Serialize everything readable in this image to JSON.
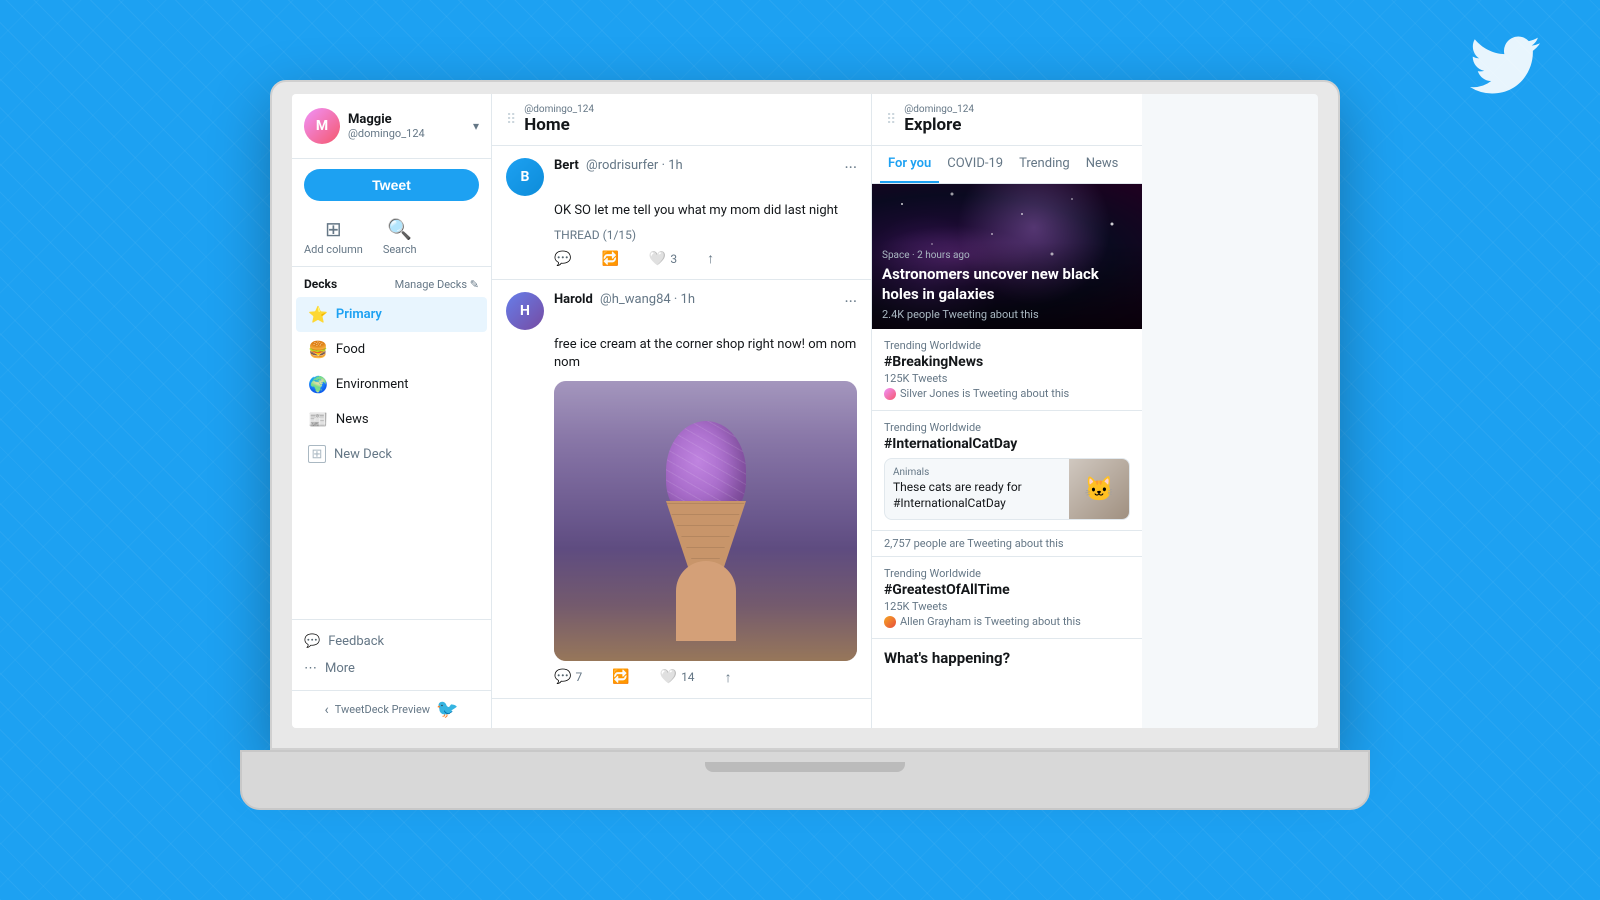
{
  "background": {
    "color": "#1da1f2"
  },
  "twitter_logo": "🐦",
  "laptop": {
    "screen": {
      "sidebar": {
        "user": {
          "name": "Maggie",
          "handle": "@domingo_124",
          "avatar_letter": "M"
        },
        "tweet_button": "Tweet",
        "actions": [
          {
            "icon": "⊞",
            "label": "Add column"
          },
          {
            "icon": "🔍",
            "label": "Search"
          }
        ],
        "decks_title": "Decks",
        "manage_decks": "Manage Decks",
        "decks": [
          {
            "icon": "⭐",
            "label": "Primary",
            "active": true,
            "color": "#f5a623"
          },
          {
            "icon": "🍔",
            "label": "Food",
            "active": false,
            "color": "#f5a623"
          },
          {
            "icon": "🌍",
            "label": "Environment",
            "active": false,
            "color": "#27ae60"
          },
          {
            "icon": "📰",
            "label": "News",
            "active": false,
            "color": "#3498db"
          },
          {
            "icon": "➕",
            "label": "New Deck",
            "active": false,
            "color": "#657786"
          }
        ],
        "footer": [
          {
            "icon": "💬",
            "label": "Feedback"
          },
          {
            "icon": "⋯",
            "label": "More"
          }
        ],
        "preview": {
          "arrow": "‹",
          "text": "TweetDeck Preview"
        }
      },
      "home_column": {
        "subtitle": "@domingo_124",
        "title": "Home",
        "tweets": [
          {
            "author": "Bert",
            "handle": "@rodrisurfer",
            "time": "1h",
            "body": "OK SO let me tell you what my mom did last night",
            "thread": "THREAD (1/15)",
            "actions": {
              "reply": "",
              "retweet": "",
              "like": "3",
              "share": ""
            }
          },
          {
            "author": "Harold",
            "handle": "@h_wang84",
            "time": "1h",
            "body": "free ice cream at the corner shop right now! om nom nom",
            "has_image": true,
            "actions": {
              "reply": "7",
              "retweet": "",
              "like": "14",
              "share": ""
            }
          }
        ]
      },
      "explore_column": {
        "subtitle": "@domingo_124",
        "title": "Explore",
        "tabs": [
          {
            "label": "For you",
            "active": true
          },
          {
            "label": "COVID-19",
            "active": false
          },
          {
            "label": "Trending",
            "active": false
          },
          {
            "label": "News",
            "active": false
          }
        ],
        "hero": {
          "category": "Space · 2 hours ago",
          "title": "Astronomers uncover new black holes in galaxies",
          "count": "2.4K people Tweeting about this"
        },
        "trending": [
          {
            "label": "Trending Worldwide",
            "tag": "#BreakingNews",
            "count": "125K Tweets",
            "user": "Silver Jones is Tweeting about this"
          },
          {
            "label": "Trending Worldwide",
            "tag": "#InternationalCatDay",
            "count": "",
            "card": {
              "category": "Animals",
              "title": "These cats are ready for #InternationalCatDay"
            },
            "people_count": "2,757 people are Tweeting about this"
          },
          {
            "label": "Trending Worldwide",
            "tag": "#GreatestOfAllTime",
            "count": "125K Tweets",
            "user": "Allen Grayham is Tweeting about this"
          }
        ],
        "whats_happening": "What's happening?"
      }
    }
  }
}
